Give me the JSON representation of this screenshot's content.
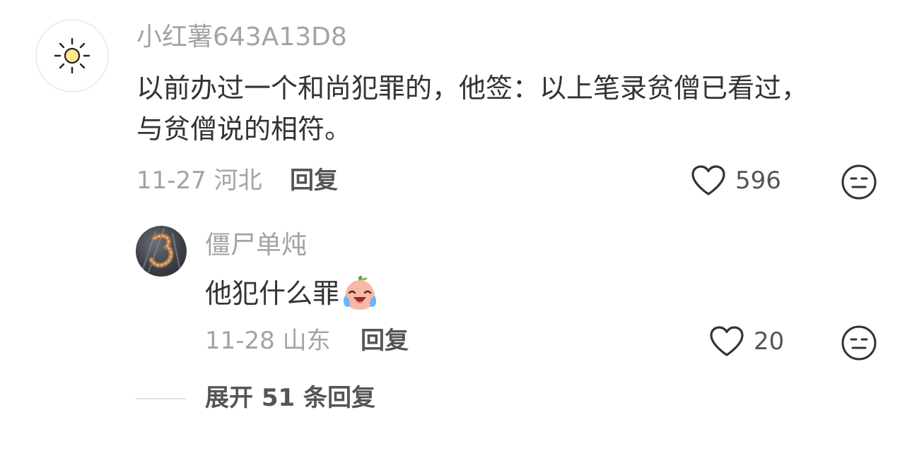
{
  "comment": {
    "username": "小红薯643A13D8",
    "text_line1": "以前办过一个和尚犯罪的，他签：以上笔录贫僧已看过，",
    "text_line2": "与贫僧说的相符。",
    "date": "11-27",
    "location": "河北",
    "reply_label": "回复",
    "likes": "596",
    "avatar_icon": "sun-icon"
  },
  "reply": {
    "username": "僵尸单炖",
    "text": "他犯什么罪",
    "emoji_icon": "crying-laughing-peach-emoji",
    "date": "11-28",
    "location": "山东",
    "reply_label": "回复",
    "likes": "20"
  },
  "expand_label": "展开 51 条回复",
  "colors": {
    "meta_gray": "#a3a3a3",
    "body_text": "#333333",
    "action_gray": "#555555"
  }
}
